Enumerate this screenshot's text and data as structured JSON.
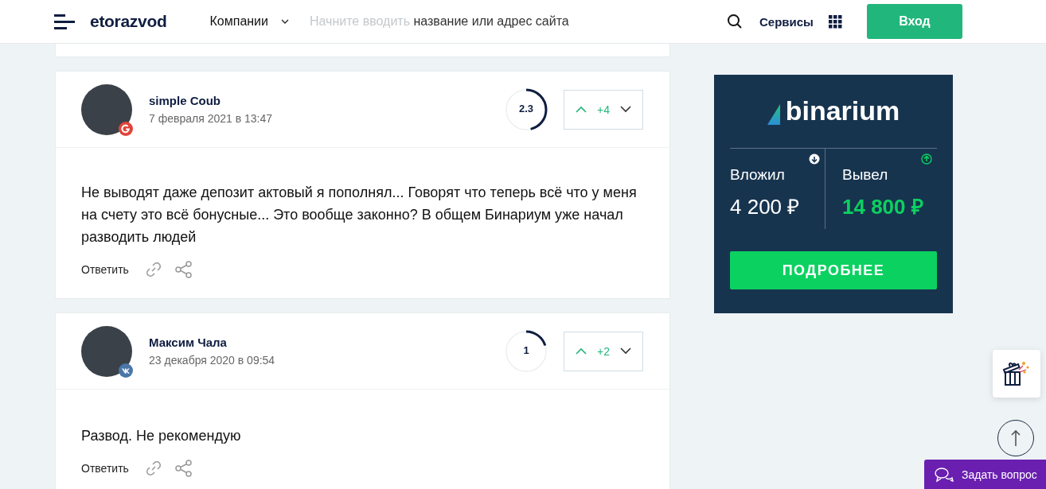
{
  "header": {
    "logo": "etorazvod",
    "companies_menu": "Компании",
    "search": {
      "prompt": "Начните вводить",
      "suggestion": "название или адрес сайта"
    },
    "services": "Сервисы",
    "login_button": "Вход"
  },
  "reviews": [
    {
      "author": "simple Coub",
      "date": "7 февраля 2021 в 13:47",
      "kind": "google",
      "rating": "2.3",
      "level": 0.46,
      "votes": "+4",
      "text": "Не выводят даже депозит актовый я пополнял... Говорят что теперь всё что у меня на счету это всё бонусные... Это вообще законно? В общем Бинариум уже начал разводить людей",
      "reply": "Ответить"
    },
    {
      "author": "Максим Чала",
      "date": "23 декабря 2020 в 09:54",
      "kind": "vk",
      "rating": "1",
      "level": 0.2,
      "votes": "+2",
      "text": "Развод. Не рекомендую",
      "reply": "Ответить"
    }
  ],
  "ad": {
    "logo": "binarium",
    "stats": [
      {
        "label": "Вложил",
        "value": "4 200 ₽",
        "kind": "in"
      },
      {
        "label": "Вывел",
        "value": "14 800 ₽",
        "kind": "out"
      }
    ],
    "button": "ПОДРОБНЕЕ"
  },
  "ask_button": "Задать вопрос"
}
